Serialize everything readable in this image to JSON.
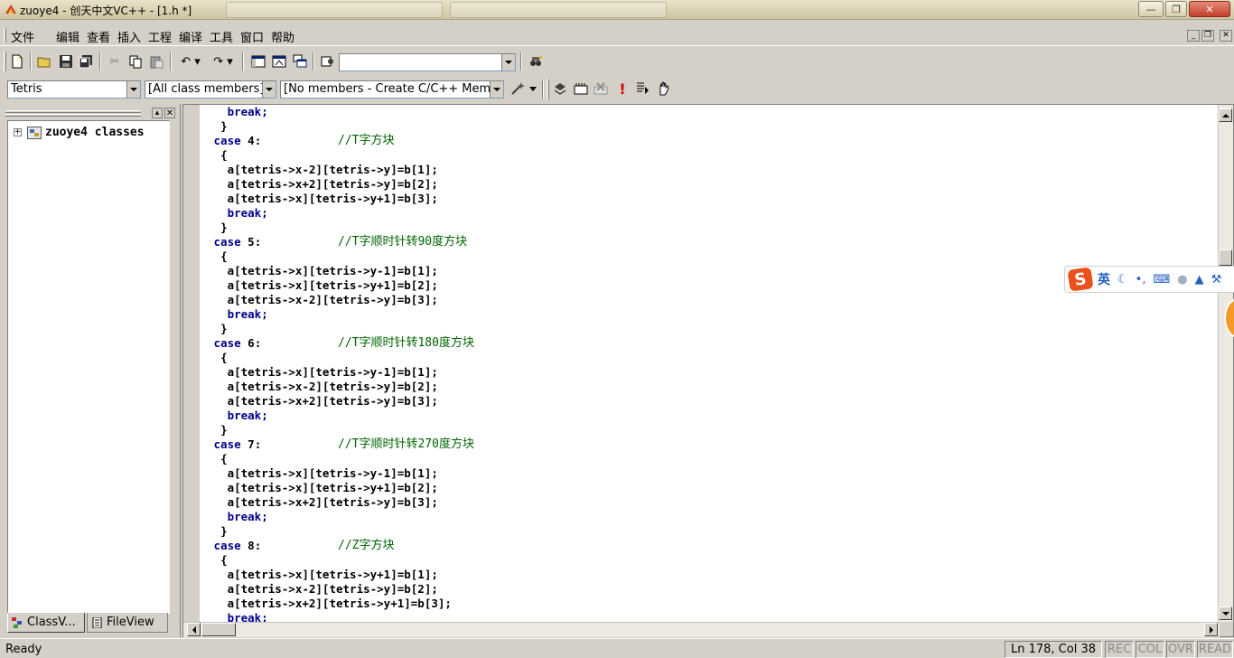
{
  "window": {
    "title": "zuoye4 - 创天中文VC++ - [1.h *]"
  },
  "menu": {
    "items": [
      "文件",
      "编辑",
      "查看",
      "插入",
      "工程",
      "编译",
      "工具",
      "窗口",
      "帮助"
    ]
  },
  "toolbar": {
    "find_combo_value": "",
    "icons": [
      "new-file-icon",
      "open-folder-icon",
      "save-icon",
      "save-all-icon",
      "cut-icon",
      "copy-icon",
      "paste-icon",
      "undo-icon",
      "redo-icon",
      "workspace-icon",
      "output-icon",
      "window-list-icon",
      "find-in-files-icon",
      "search-binoculars-icon"
    ]
  },
  "wizardbar": {
    "class_combo": "Tetris",
    "filter_combo": "[All class members]",
    "members_combo": "[No members - Create C/C++ Memb",
    "icons": [
      "wand-icon",
      "compile-icon",
      "build-icon",
      "stop-build-icon",
      "execute-icon",
      "go-debug-icon",
      "insert-breakpoint-icon"
    ]
  },
  "workspace": {
    "tree_root": "zuoye4 classes",
    "tabs": [
      "ClassV...",
      "FileView"
    ]
  },
  "editor": {
    "lines": [
      {
        "indent": "   ",
        "text": "break;",
        "kind": "kw"
      },
      {
        "indent": "  ",
        "text": "}",
        "kind": "plain"
      },
      {
        "indent": " ",
        "text": "case 4:",
        "kind": "case",
        "comment": "//T字方块"
      },
      {
        "indent": "  ",
        "text": "{",
        "kind": "plain"
      },
      {
        "indent": "   ",
        "text": "a[tetris->x-2][tetris->y]=b[1];",
        "kind": "plain"
      },
      {
        "indent": "   ",
        "text": "a[tetris->x+2][tetris->y]=b[2];",
        "kind": "plain"
      },
      {
        "indent": "   ",
        "text": "a[tetris->x][tetris->y+1]=b[3];",
        "kind": "plain"
      },
      {
        "indent": "   ",
        "text": "break;",
        "kind": "kw"
      },
      {
        "indent": "  ",
        "text": "}",
        "kind": "plain"
      },
      {
        "indent": " ",
        "text": "case 5:",
        "kind": "case",
        "comment": "//T字顺时针转90度方块"
      },
      {
        "indent": "  ",
        "text": "{",
        "kind": "plain"
      },
      {
        "indent": "   ",
        "text": "a[tetris->x][tetris->y-1]=b[1];",
        "kind": "plain"
      },
      {
        "indent": "   ",
        "text": "a[tetris->x][tetris->y+1]=b[2];",
        "kind": "plain"
      },
      {
        "indent": "   ",
        "text": "a[tetris->x-2][tetris->y]=b[3];",
        "kind": "plain"
      },
      {
        "indent": "   ",
        "text": "break;",
        "kind": "kw"
      },
      {
        "indent": "  ",
        "text": "}",
        "kind": "plain"
      },
      {
        "indent": " ",
        "text": "case 6:",
        "kind": "case",
        "comment": "//T字顺时针转180度方块"
      },
      {
        "indent": "  ",
        "text": "{",
        "kind": "plain"
      },
      {
        "indent": "   ",
        "text": "a[tetris->x][tetris->y-1]=b[1];",
        "kind": "plain"
      },
      {
        "indent": "   ",
        "text": "a[tetris->x-2][tetris->y]=b[2];",
        "kind": "plain"
      },
      {
        "indent": "   ",
        "text": "a[tetris->x+2][tetris->y]=b[3];",
        "kind": "plain"
      },
      {
        "indent": "   ",
        "text": "break;",
        "kind": "kw"
      },
      {
        "indent": "  ",
        "text": "}",
        "kind": "plain"
      },
      {
        "indent": " ",
        "text": "case 7:",
        "kind": "case",
        "comment": "//T字顺时针转270度方块"
      },
      {
        "indent": "  ",
        "text": "{",
        "kind": "plain"
      },
      {
        "indent": "   ",
        "text": "a[tetris->x][tetris->y-1]=b[1];",
        "kind": "plain"
      },
      {
        "indent": "   ",
        "text": "a[tetris->x][tetris->y+1]=b[2];",
        "kind": "plain"
      },
      {
        "indent": "   ",
        "text": "a[tetris->x+2][tetris->y]=b[3];",
        "kind": "plain"
      },
      {
        "indent": "   ",
        "text": "break;",
        "kind": "kw"
      },
      {
        "indent": "  ",
        "text": "}",
        "kind": "plain"
      },
      {
        "indent": " ",
        "text": "case 8:",
        "kind": "case",
        "comment": "//Z字方块"
      },
      {
        "indent": "  ",
        "text": "{",
        "kind": "plain"
      },
      {
        "indent": "   ",
        "text": "a[tetris->x][tetris->y+1]=b[1];",
        "kind": "plain"
      },
      {
        "indent": "   ",
        "text": "a[tetris->x-2][tetris->y]=b[2];",
        "kind": "plain"
      },
      {
        "indent": "   ",
        "text": "a[tetris->x+2][tetris->y+1]=b[3];",
        "kind": "plain"
      },
      {
        "indent": "   ",
        "text": "break;",
        "kind": "kw"
      }
    ]
  },
  "ime": {
    "logo": "S",
    "mode": "英"
  },
  "status": {
    "ready": "Ready",
    "position": "Ln 178, Col 38",
    "rec": "REC",
    "col": "COL",
    "ovr": "OVR",
    "read": "READ"
  },
  "colors": {
    "keyword": "#00008b",
    "comment": "#006400",
    "accent": "#e9521c"
  }
}
